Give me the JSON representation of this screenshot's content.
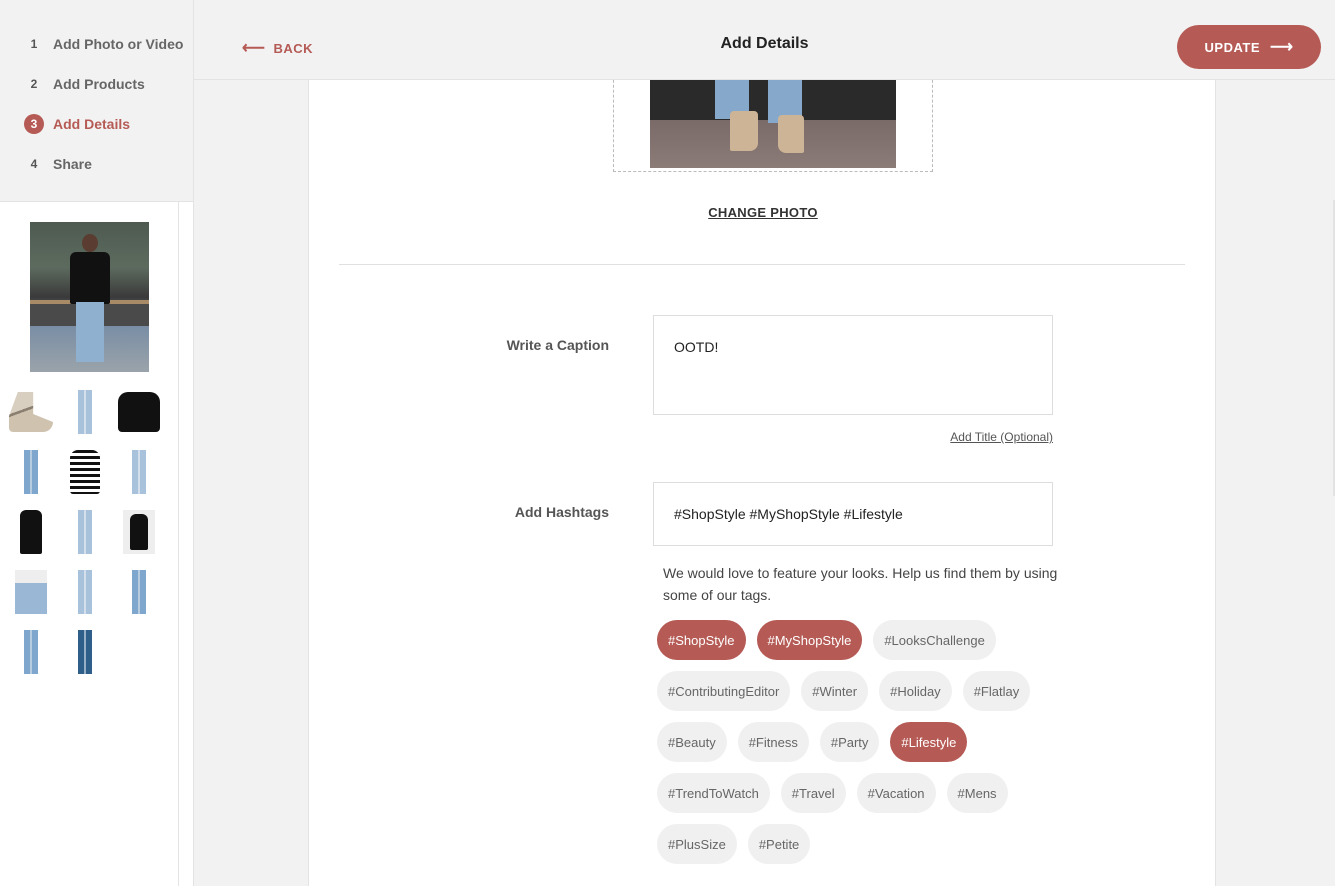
{
  "steps": [
    {
      "num": "1",
      "label": "Add Photo or Video"
    },
    {
      "num": "2",
      "label": "Add Products"
    },
    {
      "num": "3",
      "label": "Add Details"
    },
    {
      "num": "4",
      "label": "Share"
    }
  ],
  "header": {
    "back_label": "BACK",
    "title": "Add Details",
    "update_label": "UPDATE"
  },
  "photo": {
    "change_label": "CHANGE PHOTO"
  },
  "caption": {
    "label": "Write a Caption",
    "value": "OOTD!",
    "add_title_link": "Add Title (Optional)"
  },
  "hashtags": {
    "label": "Add Hashtags",
    "value": "#ShopStyle #MyShopStyle #Lifestyle",
    "help": "We would love to feature your looks. Help us find them by using some of our tags.",
    "tags": [
      {
        "label": "#ShopStyle",
        "selected": true
      },
      {
        "label": "#MyShopStyle",
        "selected": true
      },
      {
        "label": "#LooksChallenge",
        "selected": false
      },
      {
        "label": "#ContributingEditor",
        "selected": false
      },
      {
        "label": "#Winter",
        "selected": false
      },
      {
        "label": "#Holiday",
        "selected": false
      },
      {
        "label": "#Flatlay",
        "selected": false
      },
      {
        "label": "#Beauty",
        "selected": false
      },
      {
        "label": "#Fitness",
        "selected": false
      },
      {
        "label": "#Party",
        "selected": false
      },
      {
        "label": "#Lifestyle",
        "selected": true
      },
      {
        "label": "#TrendToWatch",
        "selected": false
      },
      {
        "label": "#Travel",
        "selected": false
      },
      {
        "label": "#Vacation",
        "selected": false
      },
      {
        "label": "#Mens",
        "selected": false
      },
      {
        "label": "#PlusSize",
        "selected": false
      },
      {
        "label": "#Petite",
        "selected": false
      }
    ]
  },
  "colors": {
    "accent": "#b55a55",
    "tag_bg": "#f0f0f0"
  },
  "icons": {
    "back": "arrow-left-icon",
    "update": "arrow-right-icon"
  }
}
